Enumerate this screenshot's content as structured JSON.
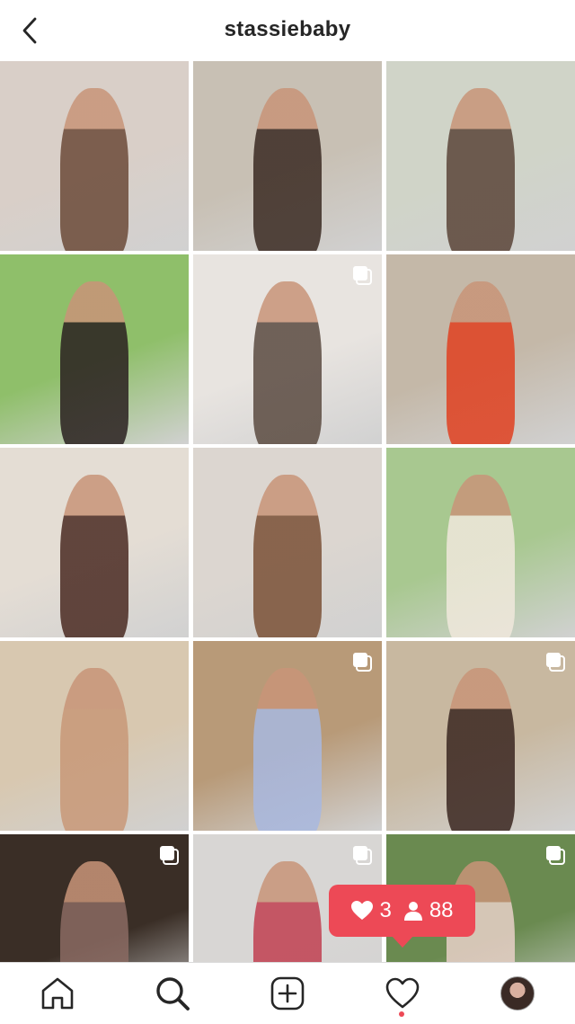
{
  "header": {
    "title": "stassiebaby"
  },
  "grid": {
    "posts": [
      {
        "bg": "#d9cfc8",
        "accent": "#6b4a38",
        "multi": false
      },
      {
        "bg": "#c8c0b4",
        "accent": "#3a2a22",
        "multi": false
      },
      {
        "bg": "#d0d4c8",
        "accent": "#5a4438",
        "multi": false
      },
      {
        "bg": "#8fbf6a",
        "accent": "#2a2020",
        "multi": false
      },
      {
        "bg": "#e8e4e0",
        "accent": "#5a4a40",
        "multi": true
      },
      {
        "bg": "#c4b8a8",
        "accent": "#e04020",
        "multi": false
      },
      {
        "bg": "#e4ddd4",
        "accent": "#4a2a22",
        "multi": false
      },
      {
        "bg": "#dcd6d0",
        "accent": "#7a5036",
        "multi": false
      },
      {
        "bg": "#a8c890",
        "accent": "#f0e8dc",
        "multi": false
      },
      {
        "bg": "#d8c8b0",
        "accent": "#c89878",
        "multi": false
      },
      {
        "bg": "#b89a78",
        "accent": "#a8b8e0",
        "multi": true
      },
      {
        "bg": "#c8b8a0",
        "accent": "#3a2620",
        "multi": true
      },
      {
        "bg": "#3a2e26",
        "accent": "#8a6a62",
        "multi": true
      },
      {
        "bg": "#d8d6d4",
        "accent": "#c04050",
        "multi": true
      },
      {
        "bg": "#6a8a50",
        "accent": "#e8d0c8",
        "multi": true
      }
    ]
  },
  "notification": {
    "likes": "3",
    "follows": "88",
    "color": "#ed4956"
  },
  "tabbar": {
    "items": [
      "home-icon",
      "search-icon",
      "new-post-icon",
      "activity-icon",
      "profile-avatar"
    ]
  }
}
